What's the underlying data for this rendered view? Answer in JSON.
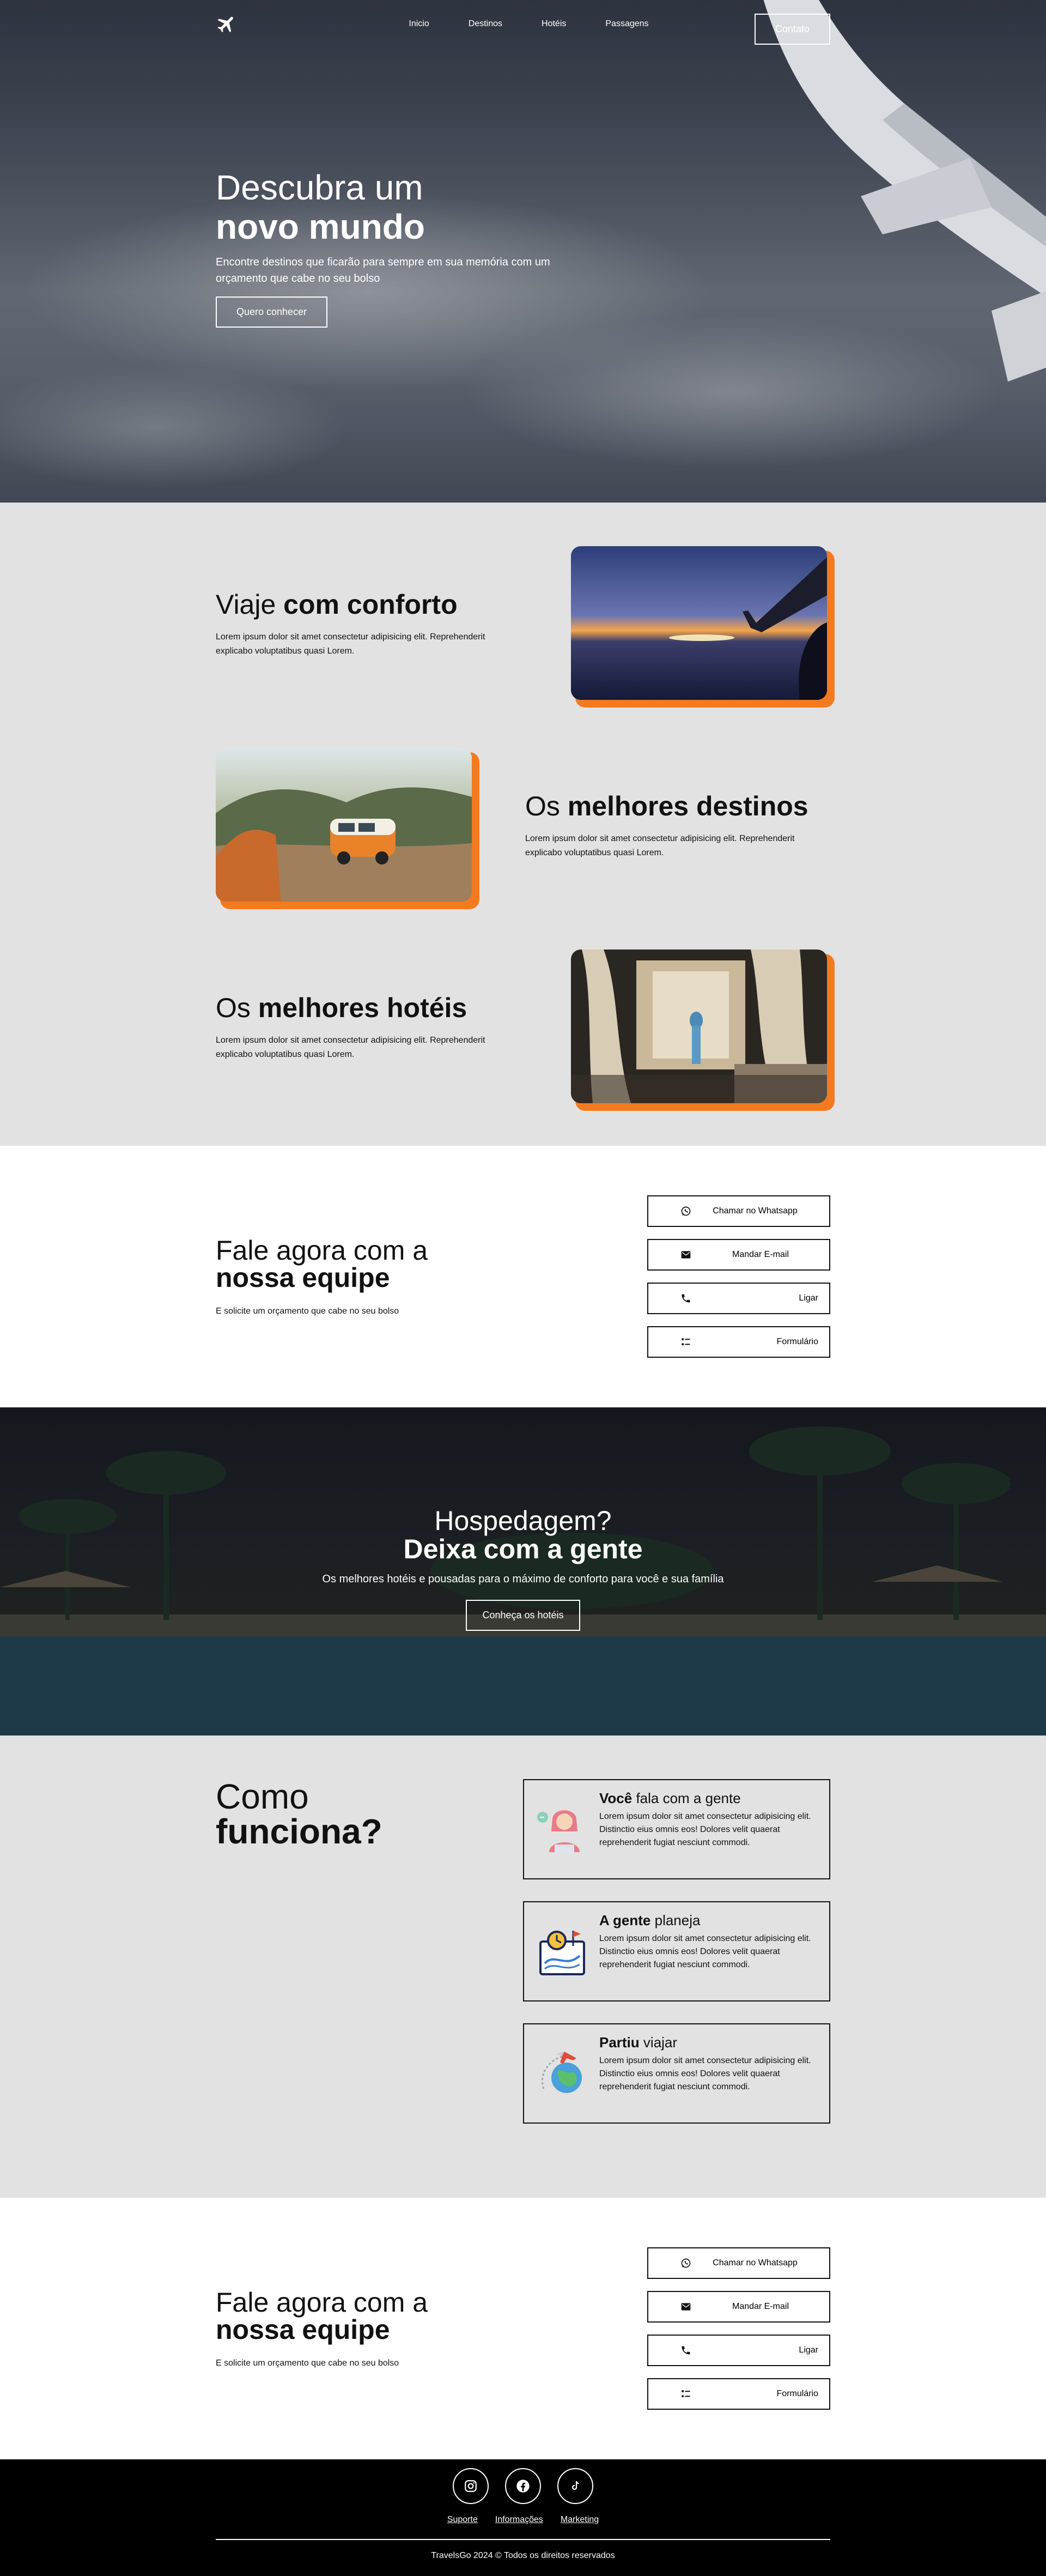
{
  "nav": {
    "links": [
      "Inicio",
      "Destinos",
      "Hotéis",
      "Passagens"
    ],
    "contact_label": "Contato"
  },
  "hero": {
    "title_line1": "Descubra um",
    "title_line2": "novo mundo",
    "subtitle": "Encontre destinos que ficarão para sempre em sua memória com um orçamento que cabe no seu bolso",
    "cta_label": "Quero conhecer"
  },
  "features": [
    {
      "title_light": "Viaje ",
      "title_bold": "com conforto",
      "desc": "Lorem ipsum dolor sit amet consectetur adipisicing elit. Reprehenderit explicabo voluptatibus quasi Lorem."
    },
    {
      "title_light": "Os ",
      "title_bold": "melhores destinos",
      "desc": "Lorem ipsum dolor sit amet consectetur adipisicing elit. Reprehenderit explicabo voluptatibus quasi Lorem."
    },
    {
      "title_light": "Os ",
      "title_bold": "melhores hotéis",
      "desc": "Lorem ipsum dolor sit amet consectetur adipisicing elit. Reprehenderit explicabo voluptatibus quasi Lorem."
    }
  ],
  "contact": {
    "title_light": "Fale agora com a",
    "title_bold": "nossa equipe",
    "subtitle": "E solicite um orçamento que cabe no seu bolso",
    "buttons": [
      {
        "label": "Chamar no Whatsapp",
        "icon": "whatsapp-icon"
      },
      {
        "label": "Mandar E-mail",
        "icon": "email-icon"
      },
      {
        "label": "Ligar",
        "icon": "phone-icon"
      },
      {
        "label": "Formulário",
        "icon": "form-icon"
      }
    ]
  },
  "hotel_banner": {
    "title_line1": "Hospedagem?",
    "title_line2": "Deixa com a gente",
    "subtitle": "Os melhores hotéis e pousadas para o máximo de conforto para você e sua família",
    "cta_label": "Conheça os hotéis"
  },
  "how": {
    "title_line1": "Como",
    "title_line2": "funciona?",
    "steps": [
      {
        "title_bold": "Você",
        "title_light": " fala com a gente",
        "desc": "Lorem ipsum dolor sit amet consectetur adipisicing elit. Distinctio eius omnis eos! Dolores velit quaerat reprehenderit fugiat nesciunt commodi.",
        "icon": "support-agent-icon"
      },
      {
        "title_bold": "A gente",
        "title_light": " planeja",
        "desc": "Lorem ipsum dolor sit amet consectetur adipisicing elit. Distinctio eius omnis eos! Dolores velit quaerat reprehenderit fugiat nesciunt commodi.",
        "icon": "planning-map-icon"
      },
      {
        "title_bold": "Partiu",
        "title_light": " viajar",
        "desc": "Lorem ipsum dolor sit amet consectetur adipisicing elit. Distinctio eius omnis eos! Dolores velit quaerat reprehenderit fugiat nesciunt commodi.",
        "icon": "globe-plane-icon"
      }
    ]
  },
  "footer": {
    "social": [
      "instagram-icon",
      "facebook-icon",
      "tiktok-icon"
    ],
    "links": [
      "Suporte",
      "Informações",
      "Marketing"
    ],
    "copyright": "TravelsGo 2024 © Todos os direitos reservados"
  },
  "colors": {
    "accent": "#f47a20",
    "section_gray": "#e2e2e2",
    "footer_bg": "#000000"
  }
}
